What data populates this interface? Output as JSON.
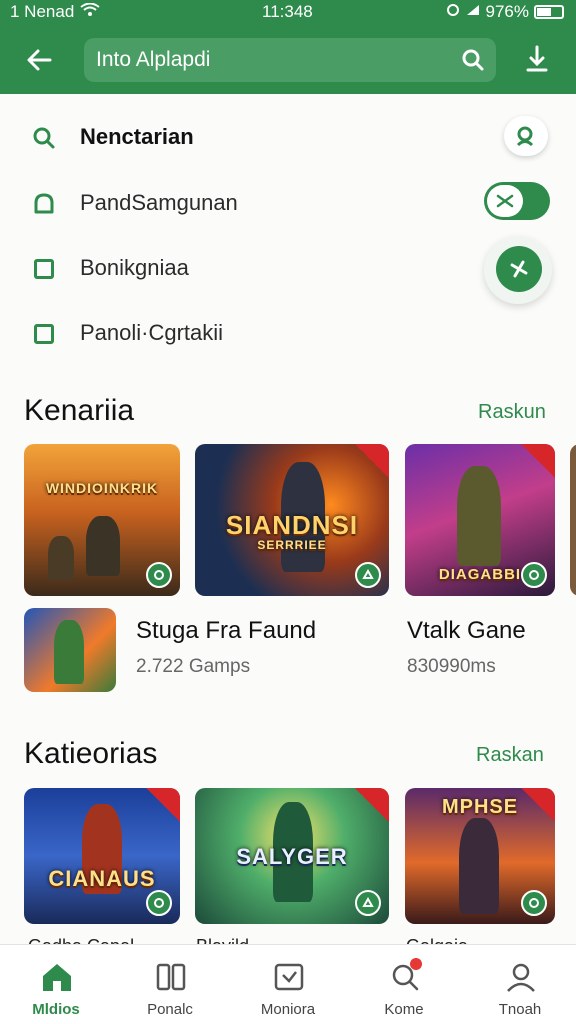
{
  "status_bar": {
    "carrier": "1 Nenad",
    "time": "11:348",
    "battery": "976%"
  },
  "header": {
    "search_text": "Into Alplapdi",
    "icons": [
      "back-arrow-icon",
      "search-icon",
      "download-icon"
    ]
  },
  "menu": [
    {
      "label": "Nenctarian",
      "icon": "search-icon",
      "bold": true
    },
    {
      "label": "PandSamgunan",
      "icon": "bell-icon"
    },
    {
      "label": "Bonikgniaa",
      "icon": "square-icon"
    },
    {
      "label": "Panoli·Cgrtakii",
      "icon": "square-icon"
    }
  ],
  "controls": {
    "toggle_on": true,
    "fab_icon": "shuffle-icon"
  },
  "section1": {
    "title": "Kenariia",
    "link": "Raskun",
    "cards": [
      {
        "title": "WINDIOINKRIK"
      },
      {
        "title": "SIANDNSI",
        "subtitle": "SERRRIEE"
      },
      {
        "title": "DIAGABBI"
      }
    ],
    "list_items": [
      {
        "title": "Stuga Fra Faund",
        "sub": "2.722 Gamps"
      },
      {
        "title": "Vtalk Gane",
        "sub": "830990ms"
      }
    ]
  },
  "section2": {
    "title": "Katieorias",
    "link": "Raskan",
    "cards": [
      {
        "title": "CIANAUS"
      },
      {
        "title": "SALYGER"
      },
      {
        "title": "MPHSE"
      }
    ],
    "cut_labels": [
      "Gadha Capal",
      "Blavild",
      "Galgaia"
    ]
  },
  "bottom_nav": [
    {
      "label": "Mldios",
      "icon": "home-icon",
      "active": true
    },
    {
      "label": "Ponalc",
      "icon": "library-icon"
    },
    {
      "label": "Moniora",
      "icon": "games-icon"
    },
    {
      "label": "Kome",
      "icon": "notification-search-icon",
      "has_dot": true
    },
    {
      "label": "Tnoah",
      "icon": "profile-icon"
    }
  ],
  "colors": {
    "primary": "#2e8b4c",
    "accent_red": "#d7262a",
    "background": "#fbfcfa"
  }
}
